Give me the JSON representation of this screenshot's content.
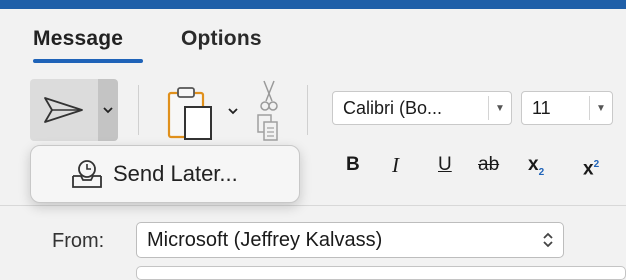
{
  "tabs": {
    "message": "Message",
    "options": "Options"
  },
  "ribbon": {
    "send": {
      "icon": "send-icon",
      "dropdown_icon": "chevron-down-icon"
    },
    "clipboard": {
      "paste_icon": "paste-icon",
      "cut_icon": "scissors-icon",
      "copy_icon": "copy-icon"
    },
    "font_name": "Calibri (Bo...",
    "font_size": "11",
    "formatting": {
      "bold": "B",
      "italic": "I",
      "underline": "U",
      "strikethrough": "ab",
      "subscript": "x",
      "subscript_mark": "2",
      "superscript": "x",
      "superscript_mark": "2"
    }
  },
  "popup": {
    "label": "Send Later...",
    "icon": "clock-tray-icon"
  },
  "header": {
    "from_label": "From:",
    "from_value": "Microsoft (Jeffrey Kalvass)"
  },
  "colors": {
    "accent": "#1f63b8",
    "topbar": "#1f5fa8",
    "background": "#f2f2f2"
  }
}
